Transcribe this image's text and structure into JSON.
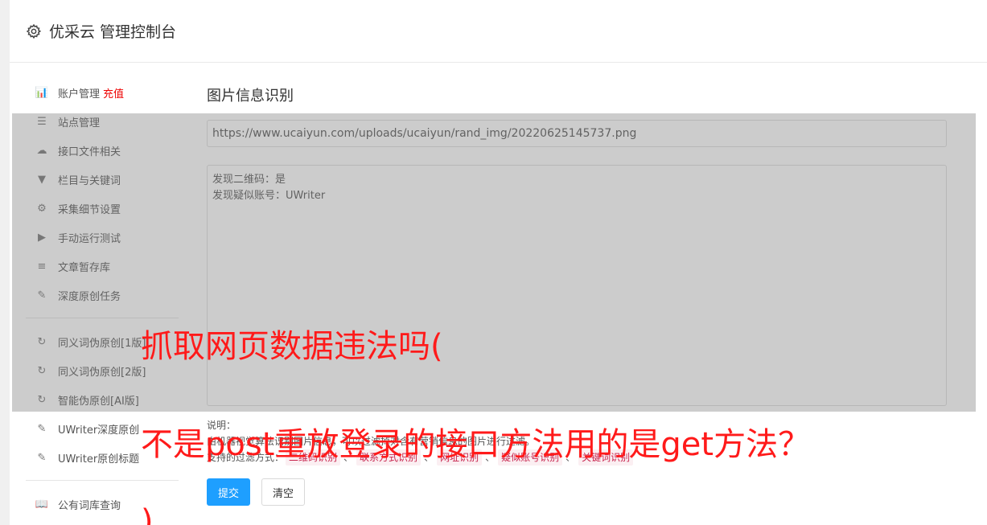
{
  "header": {
    "title": "优采云 管理控制台",
    "icon": "gear-icon"
  },
  "sidebar": {
    "items": [
      {
        "label": "账户管理",
        "badge": "充值",
        "icon": "bar-chart-icon",
        "glyph": "📊"
      },
      {
        "label": "站点管理",
        "icon": "server-icon",
        "glyph": "☰"
      },
      {
        "label": "接口文件相关",
        "icon": "cloud-upload-icon",
        "glyph": "☁"
      },
      {
        "label": "栏目与关键词",
        "icon": "filter-icon",
        "glyph": "▼"
      },
      {
        "label": "采集细节设置",
        "icon": "cogs-icon",
        "glyph": "⚙"
      },
      {
        "label": "手动运行测试",
        "icon": "play-icon",
        "glyph": "▶"
      },
      {
        "label": "文章暂存库",
        "icon": "database-icon",
        "glyph": "≡"
      },
      {
        "label": "深度原创任务",
        "icon": "edit-icon",
        "glyph": "✎"
      },
      {
        "label": "同义词伪原创[1版]",
        "icon": "refresh-icon",
        "glyph": "↻"
      },
      {
        "label": "同义词伪原创[2版]",
        "icon": "refresh-icon",
        "glyph": "↻"
      },
      {
        "label": "智能伪原创[AI版]",
        "icon": "refresh-icon",
        "glyph": "↻"
      },
      {
        "label": "UWriter深度原创",
        "icon": "edit-icon",
        "glyph": "✎"
      },
      {
        "label": "UWriter原创标题",
        "icon": "edit-icon",
        "glyph": "✎"
      },
      {
        "label": "公有词库查询",
        "icon": "book-icon",
        "glyph": "📖"
      }
    ]
  },
  "main": {
    "title": "图片信息识别",
    "url_value": "https://www.ucaiyun.com/uploads/ucaiyun/rand_img/20220625145737.png",
    "result_lines": [
      "发现二维码：是",
      "发现疑似账号：UWriter"
    ],
    "note_label": "说明：",
    "note_text": "由机器视觉算法识别图片信息，可以过滤掉对含有营销信息的图片进行过滤。",
    "filters_label": "支持的过滤方式：",
    "filters": [
      "二维码识别",
      "联系方式识别",
      "网址识别",
      "疑似账号识别",
      "关键词识别"
    ],
    "submit_label": "提交",
    "clear_label": "清空"
  },
  "captions": {
    "line1": "抓取网页数据违法吗(",
    "line2": "不是post重放登录的接口方法用的是get方法？",
    "line3": ")"
  },
  "colors": {
    "accent": "#1e9fff",
    "caption": "#ff1a1a",
    "badge": "#e00000"
  }
}
